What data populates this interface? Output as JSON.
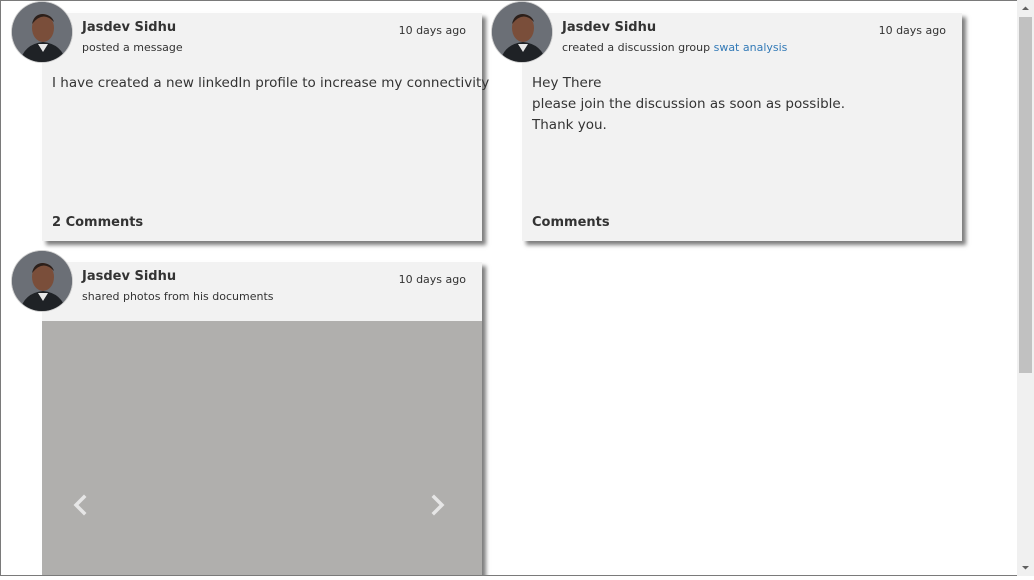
{
  "feed": {
    "posts": [
      {
        "author": "Jasdev Sidhu",
        "action": "posted a message",
        "time": "10 days ago",
        "body": [
          "I have created a new linkedIn profile to increase my connectivity"
        ],
        "comments": "2 Comments"
      },
      {
        "author": "Jasdev Sidhu",
        "action": "created a discussion group ",
        "action_link": "swat analysis",
        "time": "10 days ago",
        "body": [
          "Hey There",
          "please join the discussion as soon as possible.",
          "Thank you."
        ],
        "comments": "Comments"
      },
      {
        "author": "Jasdev Sidhu",
        "action": "shared photos from his documents",
        "time": "10 days ago",
        "gallery": {
          "prev_icon": "chevron-left-icon",
          "next_icon": "chevron-right-icon",
          "background": "#b0afad"
        }
      }
    ]
  },
  "colors": {
    "card_bg": "#f2f2f2",
    "link": "#337ab7",
    "shadow": "#7d7d7d"
  }
}
